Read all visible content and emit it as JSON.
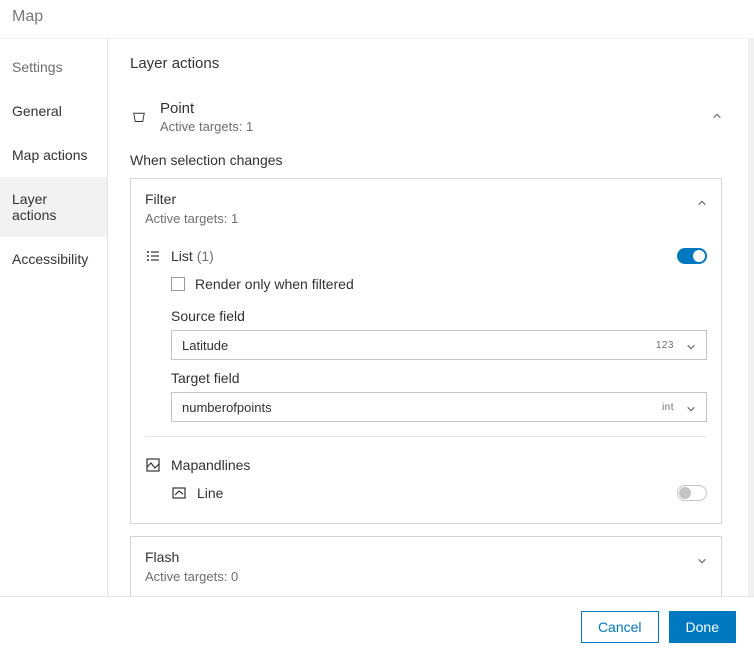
{
  "header": {
    "title": "Map"
  },
  "sidebar": {
    "items": [
      {
        "label": "Settings",
        "type": "label"
      },
      {
        "label": "General"
      },
      {
        "label": "Map actions"
      },
      {
        "label": "Layer actions",
        "active": true
      },
      {
        "label": "Accessibility"
      }
    ]
  },
  "main": {
    "title": "Layer actions",
    "layer": {
      "title": "Point",
      "sub": "Active targets: 1"
    },
    "section_label": "When selection changes",
    "filter": {
      "title": "Filter",
      "sub": "Active targets: 1",
      "list_label": "List",
      "list_count": "(1)",
      "render_label": "Render only when filtered",
      "source_label": "Source field",
      "source_value": "Latitude",
      "source_type": "123",
      "target_label": "Target field",
      "target_value": "numberofpoints",
      "target_type": "int",
      "map_label": "Mapandlines",
      "line_label": "Line"
    },
    "flash": {
      "title": "Flash",
      "sub": "Active targets: 0"
    }
  },
  "footer": {
    "cancel": "Cancel",
    "done": "Done"
  }
}
